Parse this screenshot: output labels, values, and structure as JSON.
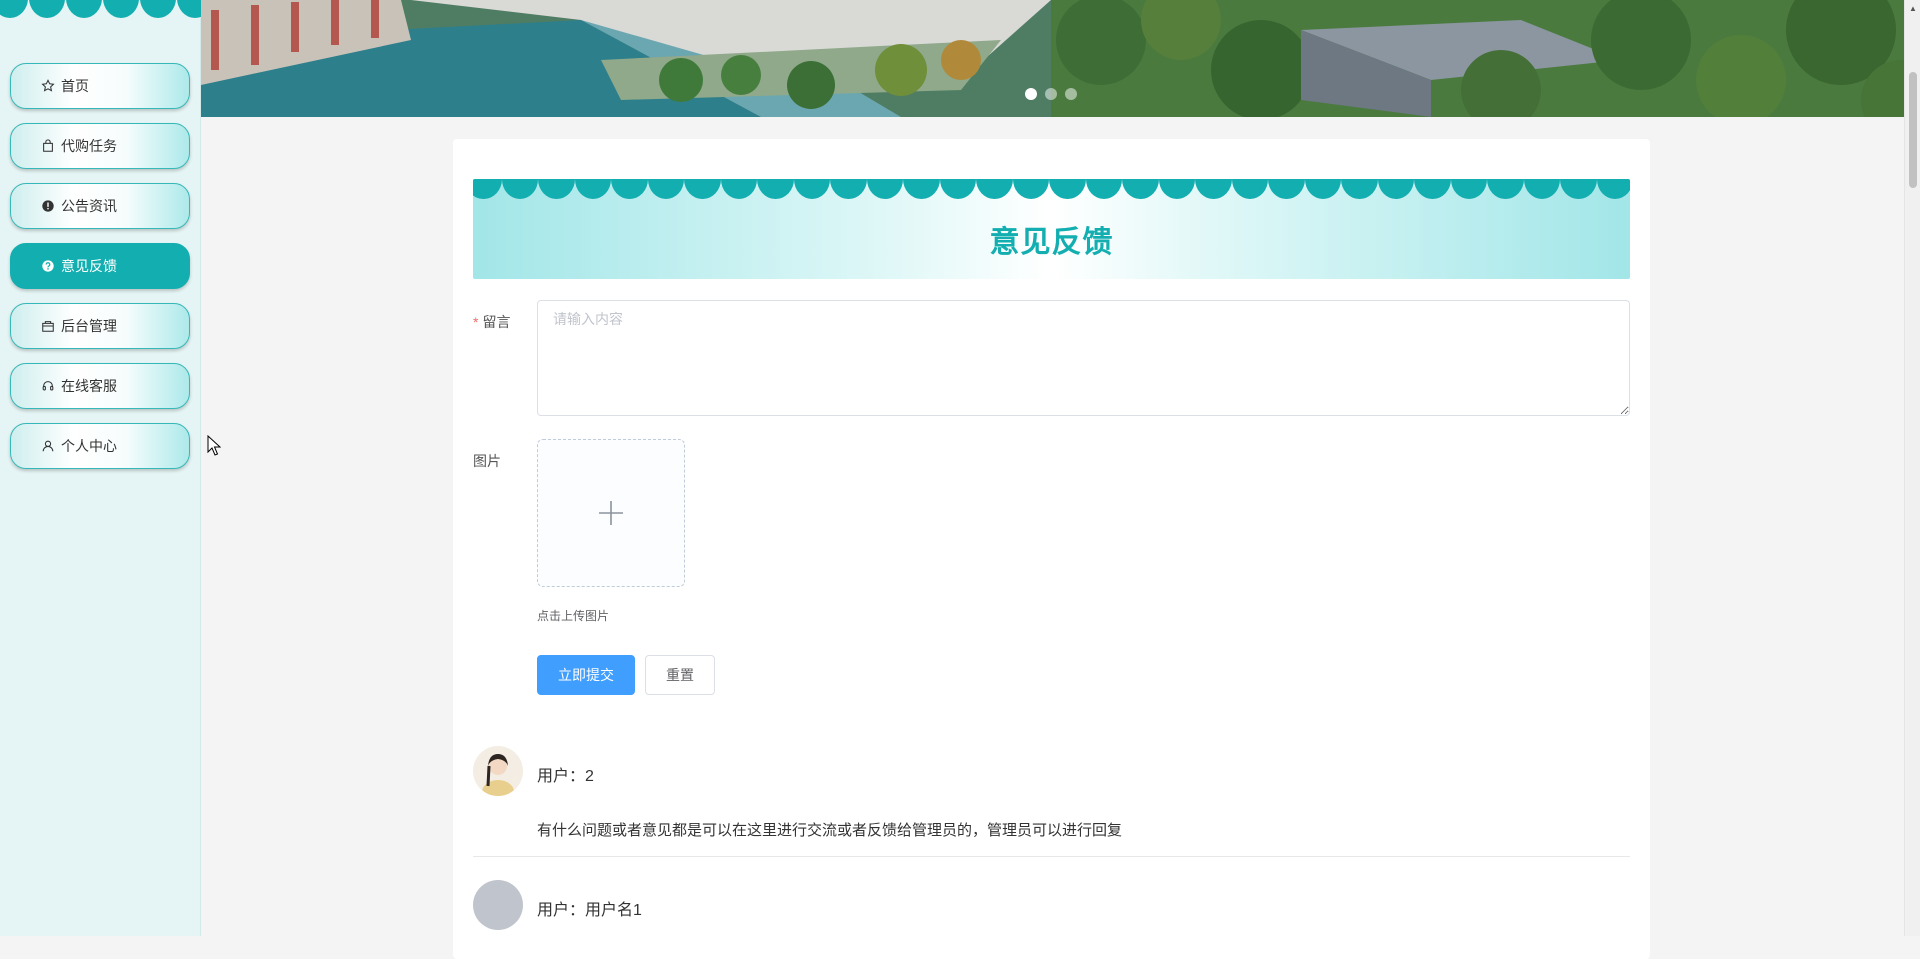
{
  "sidebar": {
    "items": [
      {
        "label": "首页",
        "icon": "star-icon",
        "active": false
      },
      {
        "label": "代购任务",
        "icon": "bag-icon",
        "active": false
      },
      {
        "label": "公告资讯",
        "icon": "info-icon",
        "active": false
      },
      {
        "label": "意见反馈",
        "icon": "question-icon",
        "active": true
      },
      {
        "label": "后台管理",
        "icon": "box-icon",
        "active": false
      },
      {
        "label": "在线客服",
        "icon": "headset-icon",
        "active": false
      },
      {
        "label": "个人中心",
        "icon": "user-icon",
        "active": false
      }
    ]
  },
  "banner": {
    "slides": 3,
    "active_slide": 1
  },
  "page": {
    "title": "意见反馈"
  },
  "form": {
    "message_label": "留言",
    "message_required": "*",
    "message_placeholder": "请输入内容",
    "message_value": "",
    "image_label": "图片",
    "upload_tip": "点击上传图片",
    "submit_label": "立即提交",
    "reset_label": "重置"
  },
  "comments": [
    {
      "user": "用户：2",
      "text": "有什么问题或者意见都是可以在这里进行交流或者反馈给管理员的，管理员可以进行回复",
      "avatar": "photo"
    },
    {
      "user": "用户：用户名1",
      "text": "",
      "avatar": "placeholder"
    }
  ],
  "colors": {
    "accent": "#13aeb0",
    "primary_button": "#409eff",
    "required": "#f56c6c"
  }
}
